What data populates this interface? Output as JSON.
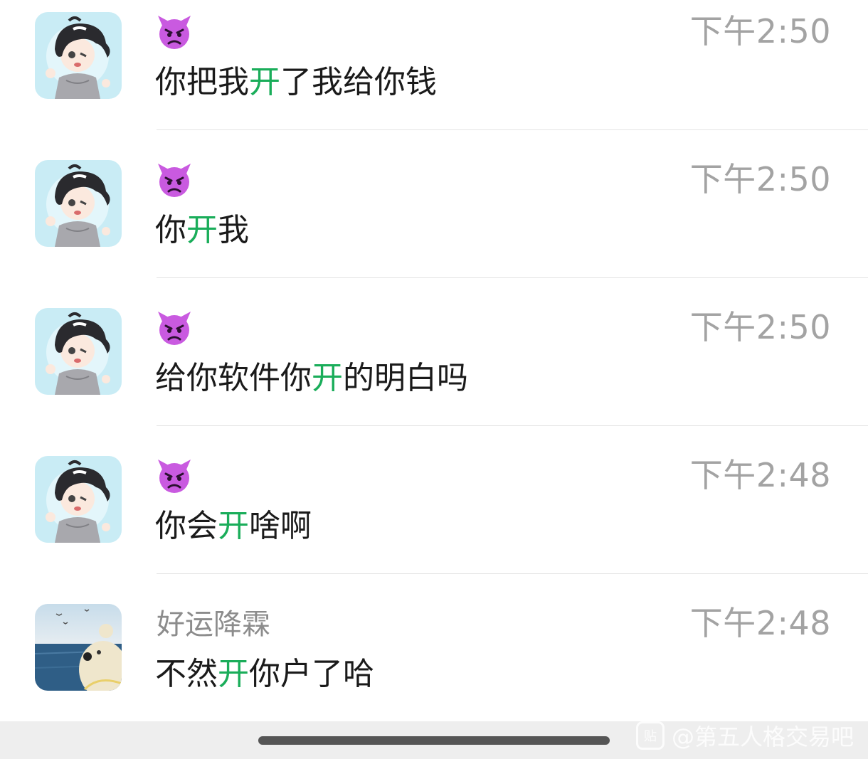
{
  "results": [
    {
      "avatar": "anime-boy-avatar",
      "sender_icon": "smiling-devil-icon",
      "sender": "",
      "time": "下午2:50",
      "message": [
        {
          "t": "你把我",
          "h": false
        },
        {
          "t": "开",
          "h": true
        },
        {
          "t": "了我给你钱",
          "h": false
        }
      ]
    },
    {
      "avatar": "anime-boy-avatar",
      "sender_icon": "smiling-devil-icon",
      "sender": "",
      "time": "下午2:50",
      "message": [
        {
          "t": "你",
          "h": false
        },
        {
          "t": "开",
          "h": true
        },
        {
          "t": "我",
          "h": false
        }
      ]
    },
    {
      "avatar": "anime-boy-avatar",
      "sender_icon": "smiling-devil-icon",
      "sender": "",
      "time": "下午2:50",
      "message": [
        {
          "t": "给你软件你",
          "h": false
        },
        {
          "t": "开",
          "h": true
        },
        {
          "t": "的明白吗",
          "h": false
        }
      ]
    },
    {
      "avatar": "anime-boy-avatar",
      "sender_icon": "smiling-devil-icon",
      "sender": "",
      "time": "下午2:48",
      "message": [
        {
          "t": "你会",
          "h": false
        },
        {
          "t": "开",
          "h": true
        },
        {
          "t": "啥啊",
          "h": false
        }
      ]
    },
    {
      "avatar": "plush-bear-sea-avatar",
      "sender_icon": "",
      "sender": "好运降霖",
      "time": "下午2:48",
      "message": [
        {
          "t": "不然",
          "h": false
        },
        {
          "t": "开",
          "h": true
        },
        {
          "t": "你户了哈",
          "h": false
        }
      ]
    }
  ],
  "colors": {
    "highlight": "#1aad5a",
    "time": "#a3a3a3",
    "sender": "#8c8c8c",
    "devil": "#c95ae0"
  },
  "watermark": {
    "logo": "贴",
    "text": "@第五人格交易吧"
  }
}
